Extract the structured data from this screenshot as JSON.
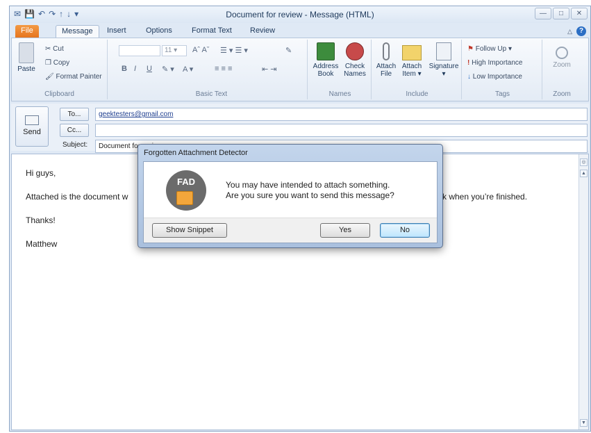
{
  "window": {
    "title": "Document for review - Message (HTML)",
    "minimize_icon": "minimize-icon",
    "maximize_icon": "maximize-icon",
    "close_icon": "close-icon"
  },
  "tabs": [
    "File",
    "Message",
    "Insert",
    "Options",
    "Format Text",
    "Review"
  ],
  "ribbon": {
    "clipboard": {
      "paste": "Paste",
      "cut": "Cut",
      "copy": "Copy",
      "format_painter": "Format Painter",
      "label": "Clipboard"
    },
    "basic_text": {
      "font_size": "11",
      "label": "Basic Text"
    },
    "names": {
      "address_book": [
        "Address",
        "Book"
      ],
      "check_names": [
        "Check",
        "Names"
      ],
      "label": "Names"
    },
    "include": {
      "attach_file": [
        "Attach",
        "File"
      ],
      "attach_item": [
        "Attach",
        "Item ▾"
      ],
      "signature": "Signature",
      "label": "Include"
    },
    "tags": {
      "follow_up": "Follow Up ▾",
      "high": "High Importance",
      "low": "Low Importance",
      "label": "Tags"
    },
    "zoom": {
      "zoom": "Zoom",
      "label": "Zoom"
    }
  },
  "compose": {
    "send": "Send",
    "to_button": "To...",
    "cc_button": "Cc...",
    "subject_label": "Subject:",
    "to_value": "geektesters@gmail.com",
    "cc_value": "",
    "subject_value": "Document for review"
  },
  "body": {
    "greeting": "Hi guys,",
    "line1_left": "Attached is the document w",
    "line1_right": "k when you’re finished.",
    "thanks": "Thanks!",
    "signoff": "Matthew"
  },
  "dialog": {
    "title": "Forgotten Attachment Detector",
    "logo": "FAD",
    "message_line1": "You may have intended to attach something.",
    "message_line2": "Are you sure you want to send this message?",
    "show_snippet": "Show Snippet",
    "yes": "Yes",
    "no": "No"
  }
}
